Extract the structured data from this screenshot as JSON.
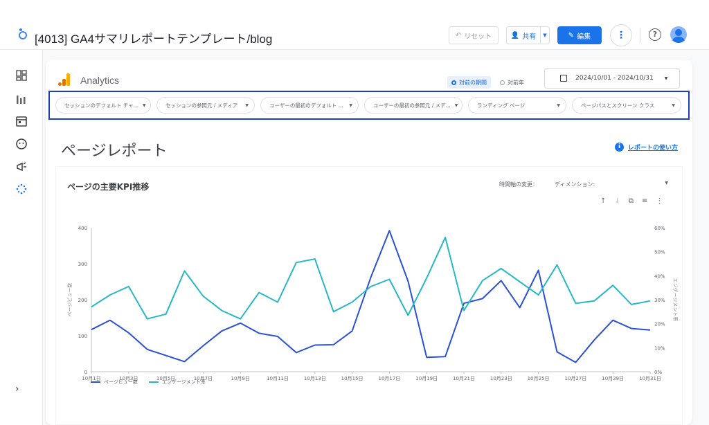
{
  "header": {
    "title": "[4013] GA4サマリレポートテンプレート/blog",
    "reset_label": "リセット",
    "share_label": "共有",
    "edit_label": "編集"
  },
  "report": {
    "brand": "Analytics",
    "period_previous": "対前の期間",
    "period_year": "対前年",
    "date_range": "2024/10/01 - 2024/10/31",
    "filters": [
      "セッションのデフォルト チャ...",
      "セッションの参照元 / メディア",
      "ユーザーの最初のデフォルト ...",
      "ユーザーの最初の参照元 / メデ...",
      "ランディング ページ",
      "ページパスとスクリーン クラス"
    ],
    "heading": "ページレポート",
    "howto_label": "レポートの使い方"
  },
  "chart_card": {
    "title": "ページの主要KPI推移",
    "time_axis_label": "時間軸の変更：",
    "dimension_label": "ディメンション:"
  },
  "colors": {
    "pageviews": "#2a4fd6",
    "engagement": "#26b8c4",
    "filter_border": "#1a3fbf",
    "accent": "#1a73e8"
  },
  "chart_data": {
    "type": "line",
    "x": [
      "10月1日",
      "10月2日",
      "10月3日",
      "10月4日",
      "10月5日",
      "10月6日",
      "10月7日",
      "10月8日",
      "10月9日",
      "10月10日",
      "10月11日",
      "10月12日",
      "10月13日",
      "10月14日",
      "10月15日",
      "10月16日",
      "10月17日",
      "10月18日",
      "10月19日",
      "10月20日",
      "10月21日",
      "10月22日",
      "10月23日",
      "10月24日",
      "10月25日",
      "10月26日",
      "10月27日",
      "10月28日",
      "10月29日",
      "10月30日",
      "10月31日"
    ],
    "x_ticks": [
      "10月1日",
      "10月3日",
      "10月5日",
      "10月7日",
      "10月9日",
      "10月11日",
      "10月13日",
      "10月15日",
      "10月17日",
      "10月19日",
      "10月21日",
      "10月23日",
      "10月25日",
      "10月27日",
      "10月29日",
      "10月31日"
    ],
    "series": [
      {
        "name": "ページビュー数",
        "axis": "left",
        "values": [
          117,
          143,
          108,
          62,
          45,
          28,
          72,
          113,
          135,
          107,
          98,
          53,
          74,
          75,
          113,
          262,
          392,
          252,
          40,
          42,
          190,
          203,
          253,
          178,
          282,
          55,
          26,
          88,
          143,
          120,
          116
        ]
      },
      {
        "name": "エンゲージメント率",
        "axis": "right",
        "values": [
          27,
          32,
          35.5,
          22,
          24,
          42,
          31.5,
          25.5,
          22,
          33,
          29,
          45.5,
          47,
          25,
          29,
          35.5,
          38.5,
          23.5,
          39,
          56,
          25.5,
          38,
          43,
          37.5,
          32,
          44.5,
          28.5,
          29.5,
          36,
          28,
          29.5
        ]
      }
    ],
    "ylabel": "ページビュー数",
    "ylabel_right": "エンゲージメント率",
    "ylim": [
      0,
      400
    ],
    "yticks": [
      "0",
      "100",
      "200",
      "300",
      "400"
    ],
    "ylim_right": [
      0,
      60
    ],
    "yticks_right": [
      "0%",
      "10%",
      "20%",
      "30%",
      "40%",
      "50%",
      "60%"
    ],
    "legend_position": "bottom-left",
    "grid": false
  }
}
